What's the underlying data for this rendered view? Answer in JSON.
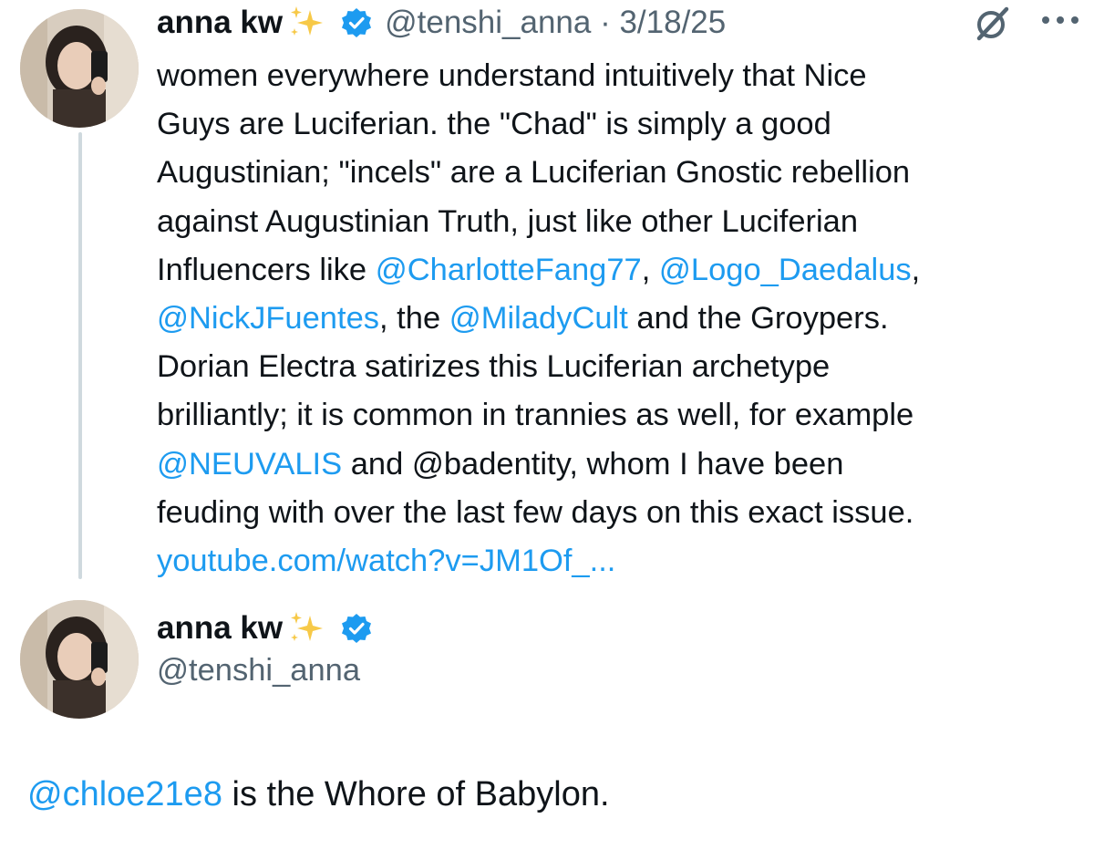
{
  "tweet": {
    "author_name": "anna kw",
    "sparkle_emoji": "sparkles-emoji",
    "verified_badge": "verified-badge-icon",
    "handle_date": "@tenshi_anna · 3/18/25",
    "grok_icon": "grok-icon",
    "more_icon": "more-options-icon",
    "lines": [
      [
        {
          "text": "women everywhere understand intuitively that Nice"
        }
      ],
      [
        {
          "text": "Guys are Luciferian. the \"Chad\" is simply a good"
        }
      ],
      [
        {
          "text": "Augustinian; \"incels\" are a Luciferian Gnostic rebellion"
        }
      ],
      [
        {
          "text": "against Augustinian Truth, just like other Luciferian"
        }
      ],
      [
        {
          "text": "Influencers like "
        },
        {
          "text": "@CharlotteFang77",
          "link": true
        },
        {
          "text": ", "
        },
        {
          "text": "@Logo_Daedalus",
          "link": true
        },
        {
          "text": ","
        }
      ],
      [
        {
          "text": "@NickJFuentes",
          "link": true
        },
        {
          "text": ", the "
        },
        {
          "text": "@MiladyCult",
          "link": true
        },
        {
          "text": " and the Groypers."
        }
      ],
      [
        {
          "text": "Dorian Electra satirizes this Luciferian archetype"
        }
      ],
      [
        {
          "text": "brilliantly; it is common in trannies as well, for example"
        }
      ],
      [
        {
          "text": "@NEUVALIS",
          "link": true
        },
        {
          "text": " and @badentity, whom I have been"
        }
      ],
      [
        {
          "text": "feuding with over the last few days on this exact issue."
        }
      ],
      [
        {
          "text": "youtube.com/watch?v=JM1Of_...",
          "link": true
        }
      ]
    ]
  },
  "profile": {
    "name": "anna kw",
    "handle": "@tenshi_anna",
    "bio": [
      {
        "text": "@chloe21e8",
        "link": true
      },
      {
        "text": " is the Whore of Babylon."
      }
    ]
  },
  "colors": {
    "link": "#1d9bf0",
    "text": "#0f1419",
    "muted": "#536471",
    "verified": "#1d9bf0",
    "thread_line": "#cfd9de"
  }
}
